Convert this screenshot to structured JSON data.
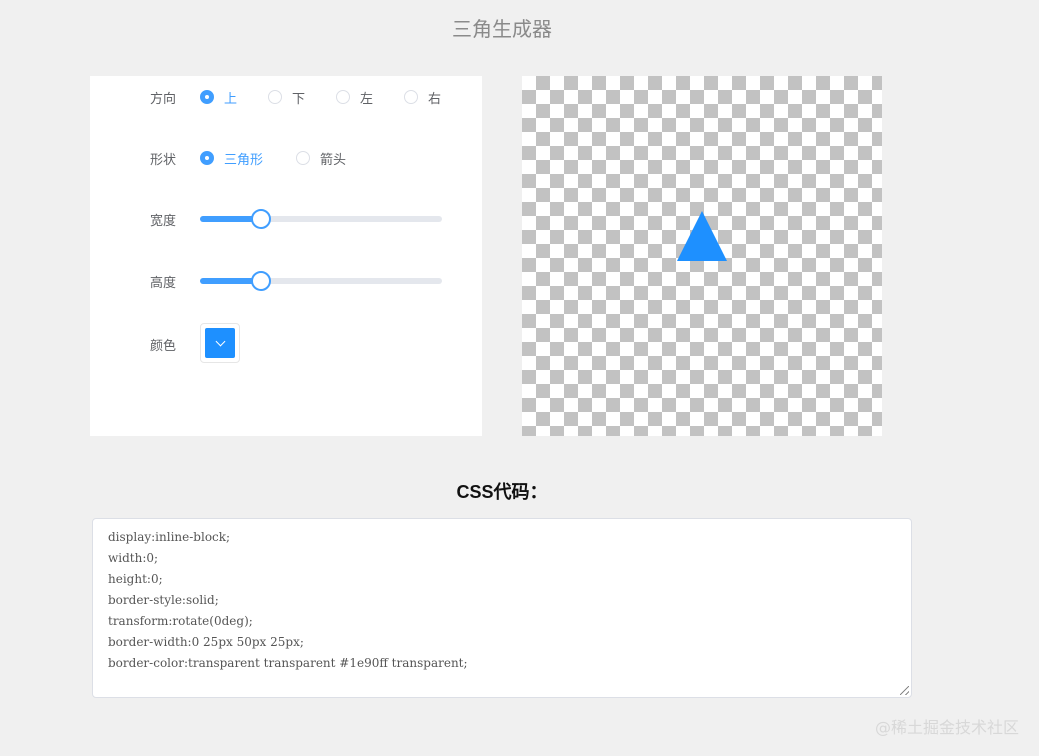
{
  "title": "三角生成器",
  "controls": {
    "direction": {
      "label": "方向",
      "options": [
        "上",
        "下",
        "左",
        "右"
      ],
      "selected_index": 0
    },
    "shape": {
      "label": "形状",
      "options": [
        "三角形",
        "箭头"
      ],
      "selected_index": 0
    },
    "width": {
      "label": "宽度",
      "value_percent": 25
    },
    "height": {
      "label": "高度",
      "value_percent": 25
    },
    "color": {
      "label": "颜色",
      "value": "#1e90ff"
    }
  },
  "code": {
    "heading": "CSS代码：",
    "lines": [
      "display:inline-block;",
      "width:0;",
      "height:0;",
      "border-style:solid;",
      "transform:rotate(0deg);",
      "border-width:0 25px 50px 25px;",
      "border-color:transparent transparent #1e90ff transparent;"
    ]
  },
  "watermark": "@稀土掘金技术社区",
  "colors": {
    "accent": "#409eff",
    "triangle": "#1e90ff"
  }
}
